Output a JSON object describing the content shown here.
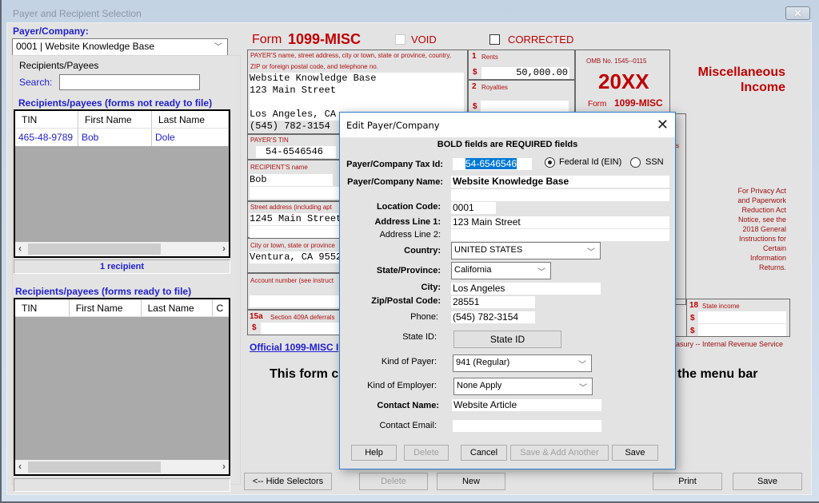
{
  "window": {
    "title": "Payer and Recipient Selection",
    "close_icon": "close-icon"
  },
  "left_panel": {
    "payer_label": "Payer/Company:",
    "payer_selected": "0001 | Website Knowledge Base",
    "group_label": "Recipients/Payees",
    "search_label": "Search:",
    "search_value": "",
    "not_ready": {
      "title": "Recipients/payees (forms not ready to file)",
      "columns": [
        "TIN",
        "First Name",
        "Last Name"
      ],
      "rows": [
        {
          "tin": "465-48-9789",
          "first": "Bob",
          "last": "Dole"
        }
      ],
      "status": "1 recipient"
    },
    "ready": {
      "title": "Recipients/payees (forms ready to file)",
      "columns": [
        "TIN",
        "First Name",
        "Last Name",
        "C"
      ],
      "rows": [],
      "status": ""
    }
  },
  "form": {
    "form_word": "Form",
    "form_name": "1099-MISC",
    "void_label": "VOID",
    "corrected_label": "CORRECTED",
    "payer_box_label_1": "PAYER'S name, street address, city or town, state or province, country,",
    "payer_box_label_2": "ZIP or foreign postal code, and telephone no.",
    "payer_lines": [
      "Website Knowledge Base",
      "123 Main Street",
      "",
      "Los Angeles, CA",
      "(545) 782-3154"
    ],
    "payer_tin_label": "PAYER'S TIN",
    "payer_tin": "54-6546546",
    "recipient_name_label": "RECIPIENT'S name",
    "recipient_name": "Bob",
    "street_label": "Street address (including apt",
    "street": "1245 Main Street",
    "city_label": "City or town, state or province",
    "city": "Ventura, CA 9552",
    "account_label": "Account number (see instruct",
    "box15a_num": "15a",
    "box15a_label": "Section 409A deferrals",
    "box1_num": "1",
    "box1_label": "Rents",
    "box1_value": "50,000.00",
    "box2_num": "2",
    "box2_label": "Royalties",
    "dollar": "$",
    "omb": "OMB No. 1545--0115",
    "year": "20XX",
    "title_line1": "Miscellaneous",
    "title_line2": "Income",
    "privacy_lines": [
      "For Privacy Act",
      "and Paperwork",
      "Reduction Act",
      "Notice, see the",
      "2018 General",
      "Instructions for",
      "Certain",
      "Information",
      "Returns."
    ],
    "box18_num": "18",
    "box18_label": "State income",
    "irs_text": "Department of the Treasury -- Internal Revenue Service",
    "irs_visible": "asury -- Internal Revenue Service",
    "official_link": "Official 1099-MISC  I",
    "notice_left": "This form c",
    "notice_right": "the menu bar",
    "box_fragment": "s"
  },
  "bottom_buttons": {
    "hide_selectors": "<-- Hide Selectors",
    "delete": "Delete",
    "new": "New",
    "print": "Print",
    "save": "Save"
  },
  "dialog": {
    "title": "Edit Payer/Company",
    "notice": "BOLD fields are REQUIRED fields",
    "tax_id_label": "Payer/Company Tax Id:",
    "tax_id": "54-6546546",
    "id_type_options": [
      "Federal Id (EIN)",
      "SSN"
    ],
    "id_type_selected": "Federal Id (EIN)",
    "name_label": "Payer/Company Name:",
    "name": "Website Knowledge Base",
    "name2": "",
    "location_label": "Location Code:",
    "location": "0001",
    "addr1_label": "Address Line 1:",
    "addr1": "123 Main Street",
    "addr2_label": "Address Line 2:",
    "addr2": "",
    "country_label": "Country:",
    "country": "UNITED STATES",
    "state_label": "State/Province:",
    "state": "California",
    "city_label": "City:",
    "city": "Los Angeles",
    "zip_label": "Zip/Postal Code:",
    "zip": "28551",
    "phone_label": "Phone:",
    "phone": "(545) 782-3154",
    "state_id_label": "State ID:",
    "state_id_button": "State ID",
    "kind_payer_label": "Kind of Payer:",
    "kind_payer": "941 (Regular)",
    "kind_employer_label": "Kind of Employer:",
    "kind_employer": "None Apply",
    "contact_name_label": "Contact Name:",
    "contact_name": "Website Article",
    "contact_email_label": "Contact Email:",
    "contact_email": "",
    "buttons": {
      "help": "Help",
      "delete": "Delete",
      "cancel": "Cancel",
      "save_add": "Save & Add Another",
      "save": "Save"
    }
  }
}
